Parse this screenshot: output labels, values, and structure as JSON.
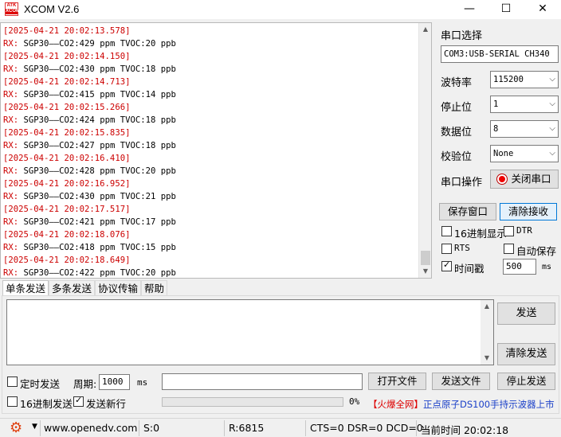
{
  "window": {
    "logo_text_top": "ATK",
    "logo_text_bottom": "XCOM",
    "title": "XCOM V2.6",
    "minimize": "—",
    "maximize": "☐",
    "close": "✕"
  },
  "receive": {
    "lines": [
      {
        "ts": "[2025-04-21 20:02:13.578]",
        "rx": "",
        "msg": ""
      },
      {
        "ts": "",
        "rx": "RX:",
        "msg": " SGP30——CO2:429 ppm TVOC:20 ppb"
      },
      {
        "ts": "[2025-04-21 20:02:14.150]",
        "rx": "",
        "msg": ""
      },
      {
        "ts": "",
        "rx": "RX:",
        "msg": " SGP30——CO2:430 ppm TVOC:18 ppb"
      },
      {
        "ts": "[2025-04-21 20:02:14.713]",
        "rx": "",
        "msg": ""
      },
      {
        "ts": "",
        "rx": "RX:",
        "msg": " SGP30——CO2:415 ppm TVOC:14 ppb"
      },
      {
        "ts": "[2025-04-21 20:02:15.266]",
        "rx": "",
        "msg": ""
      },
      {
        "ts": "",
        "rx": "RX:",
        "msg": " SGP30——CO2:424 ppm TVOC:18 ppb"
      },
      {
        "ts": "[2025-04-21 20:02:15.835]",
        "rx": "",
        "msg": ""
      },
      {
        "ts": "",
        "rx": "RX:",
        "msg": " SGP30——CO2:427 ppm TVOC:18 ppb"
      },
      {
        "ts": "[2025-04-21 20:02:16.410]",
        "rx": "",
        "msg": ""
      },
      {
        "ts": "",
        "rx": "RX:",
        "msg": " SGP30——CO2:428 ppm TVOC:20 ppb"
      },
      {
        "ts": "[2025-04-21 20:02:16.952]",
        "rx": "",
        "msg": ""
      },
      {
        "ts": "",
        "rx": "RX:",
        "msg": " SGP30——CO2:430 ppm TVOC:21 ppb"
      },
      {
        "ts": "[2025-04-21 20:02:17.517]",
        "rx": "",
        "msg": ""
      },
      {
        "ts": "",
        "rx": "RX:",
        "msg": " SGP30——CO2:421 ppm TVOC:17 ppb"
      },
      {
        "ts": "[2025-04-21 20:02:18.076]",
        "rx": "",
        "msg": ""
      },
      {
        "ts": "",
        "rx": "RX:",
        "msg": " SGP30——CO2:418 ppm TVOC:15 ppb"
      },
      {
        "ts": "[2025-04-21 20:02:18.649]",
        "rx": "",
        "msg": ""
      },
      {
        "ts": "",
        "rx": "RX:",
        "msg": " SGP30——CO2:422 ppm TVOC:20 ppb"
      }
    ],
    "scroll_up": "▲",
    "scroll_down": "▼"
  },
  "settings": {
    "port_label": "串口选择",
    "port_value": "COM3:USB-SERIAL CH340",
    "baud_label": "波特率",
    "baud_value": "115200",
    "stop_label": "停止位",
    "stop_value": "1",
    "data_label": "数据位",
    "data_value": "8",
    "parity_label": "校验位",
    "parity_value": "None",
    "op_label": "串口操作",
    "close_port": "关闭串口",
    "save_window": "保存窗口",
    "clear_recv": "清除接收",
    "hex_display": "16进制显示",
    "dtr": "DTR",
    "rts": "RTS",
    "auto_save": "自动保存",
    "timestamp": "时间戳",
    "timestamp_ms": "500",
    "ms": "ms",
    "chevron": "⌵"
  },
  "tabs": {
    "single": "单条发送",
    "multi": "多条发送",
    "protocol": "协议传输",
    "help": "帮助"
  },
  "send": {
    "send_button": "发送",
    "clear_send": "清除发送",
    "timed_send": "定时发送",
    "period_label": "周期:",
    "period_value": "1000",
    "ms": "ms",
    "open_file": "打开文件",
    "send_file": "发送文件",
    "stop_send": "停止发送",
    "hex_send": "16进制发送",
    "send_newline": "发送新行",
    "progress_pct": "0%",
    "progress_value": 0,
    "promo_bracket": "【火爆全网】",
    "promo_text": "正点原子DS100手持示波器上市"
  },
  "status": {
    "url": "www.openedv.com",
    "sent": "S:0",
    "received": "R:6815",
    "lines": "CTS=0 DSR=0 DCD=0",
    "time": "当前时间 20:02:18"
  }
}
